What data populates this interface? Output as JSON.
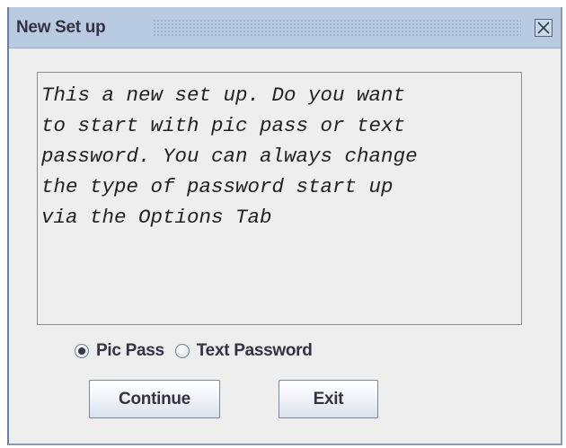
{
  "window": {
    "title": "New Set up",
    "close_icon": "close-x-icon"
  },
  "message": {
    "text": "This a new set up. Do you want\nto start with pic pass or text\npassword. You can always change\nthe type of password start up\nvia the Options Tab"
  },
  "options": {
    "pic_pass": {
      "label": "Pic Pass",
      "checked": true
    },
    "text_password": {
      "label": "Text Password",
      "checked": false
    }
  },
  "buttons": {
    "continue_label": "Continue",
    "exit_label": "Exit"
  },
  "colors": {
    "title_bar": "#b8cbe2",
    "window_bg": "#eeeeee",
    "text": "#333344"
  }
}
